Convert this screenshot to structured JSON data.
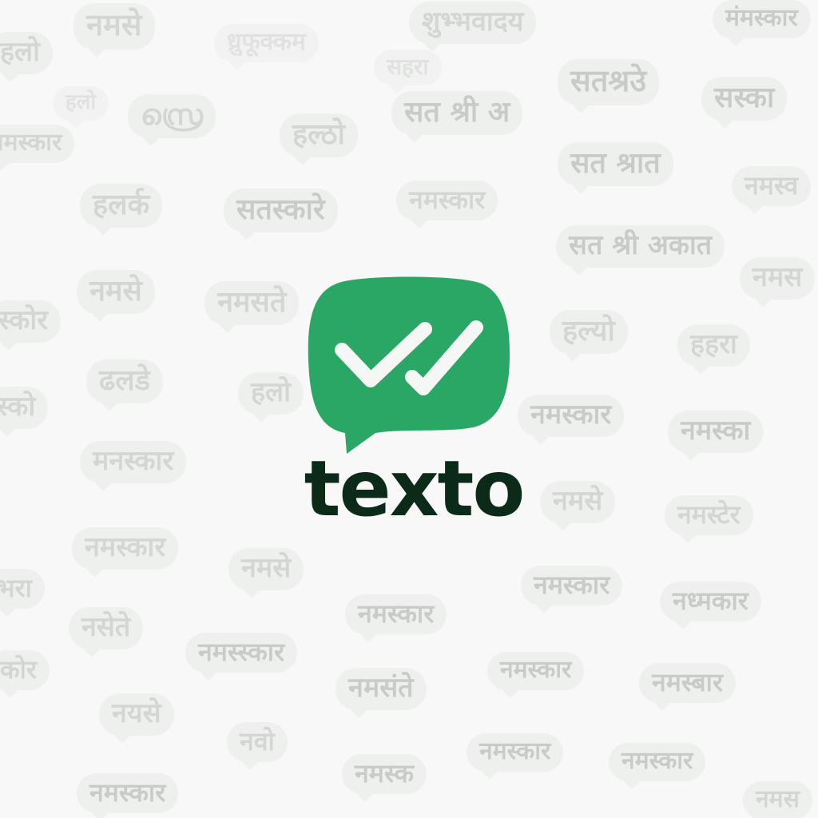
{
  "brand": {
    "name": "texto",
    "icon": "chat-bubble-double-check-icon",
    "colors": {
      "accent": "#2aa764",
      "wordmark": "#0b2a18",
      "check": "#f4f7f4",
      "background": "#f7f8f7"
    }
  },
  "background_greetings": [
    "नमसे",
    "मंमस्कार",
    "शुभ्भवादय",
    "हलो",
    "ध्रुफूक्कम",
    "सहरा",
    "सतश्रउे",
    "सस्का",
    "हलो",
    "സ്രെ",
    "सत श्री अ",
    "नमस्कार",
    "हल्ठो",
    "सत श्रात",
    "हलर्क",
    "सतस्कारे",
    "नमस्कार",
    "नमस्व",
    "सत श्री अकात",
    "नमसे",
    "नमसते",
    "नमस",
    "हल्यो",
    "हहरा",
    "स्कोर",
    "ढलडे",
    "हलो",
    "नमस्कार",
    "नमस्का",
    "स्को",
    "मनस्कार",
    "नमसे",
    "नमस्टेर",
    "नमस्कार",
    "नमसे",
    "नमस्कार",
    "नध्मकार",
    "भरा",
    "नसेते",
    "नमस्स्कार",
    "नमस्कार",
    "कोर",
    "नयसे",
    "नमसंते",
    "नमस्कार",
    "नमस्बार",
    "नवो",
    "नमस्क",
    "नमस्कार",
    "नमस्कार",
    "नमस्कार",
    "नमस"
  ]
}
